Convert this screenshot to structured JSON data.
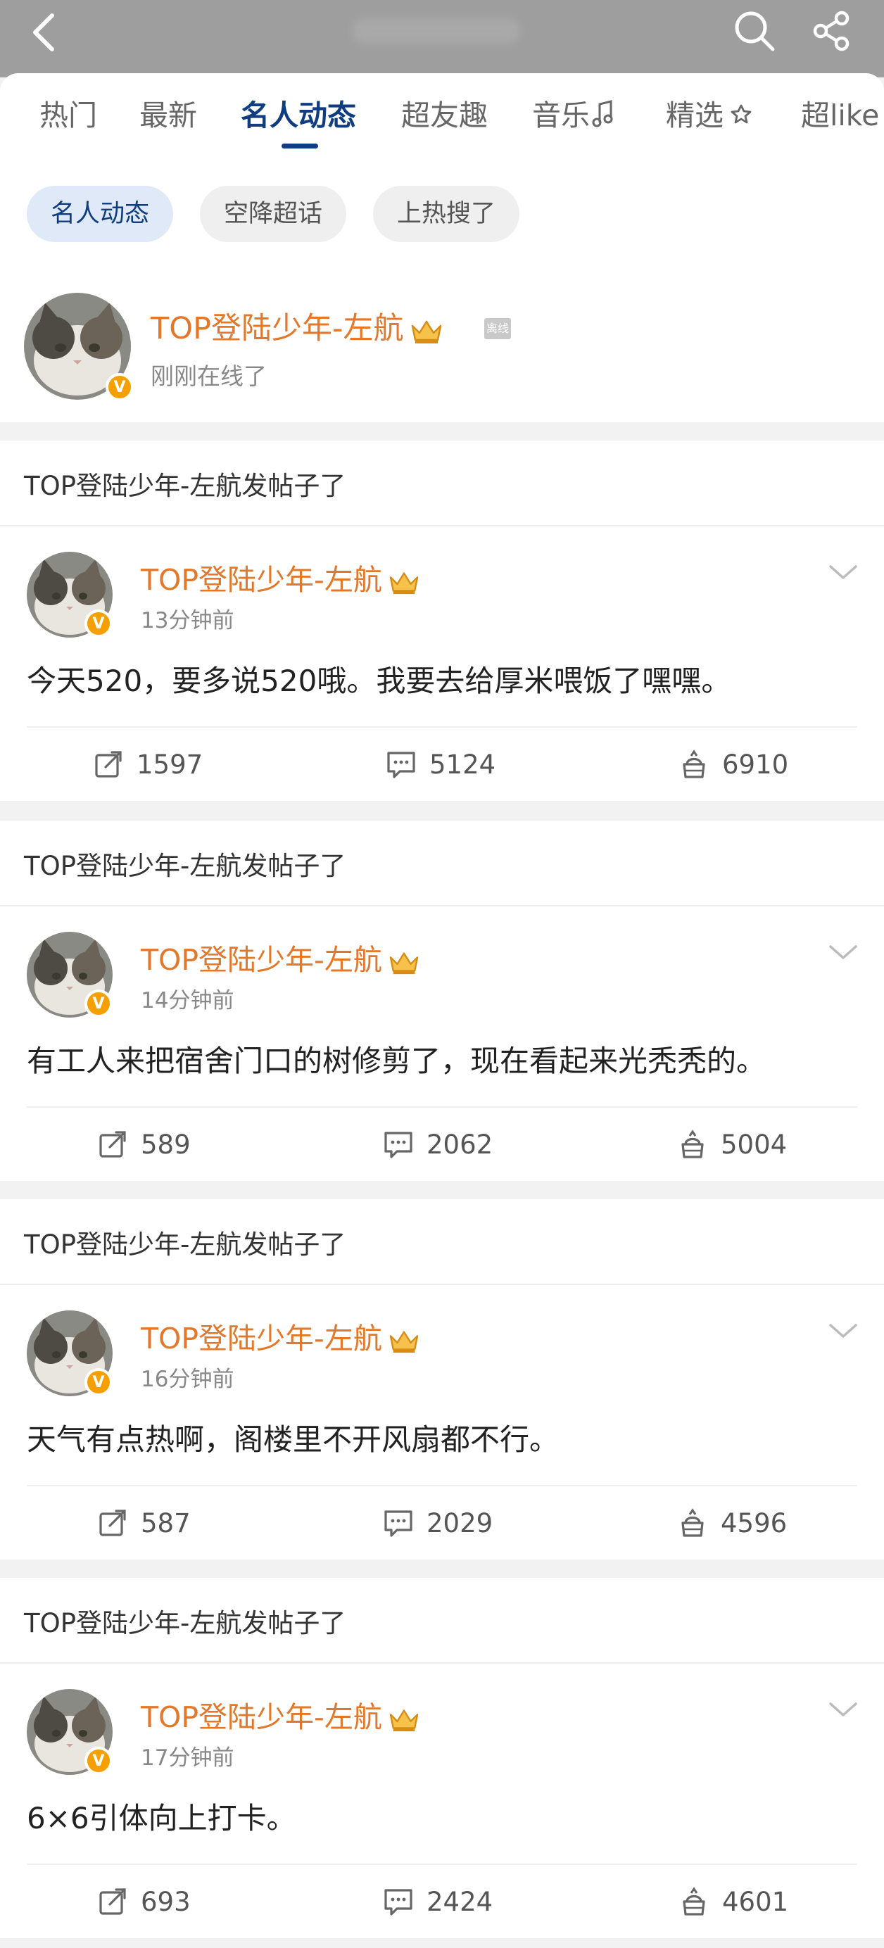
{
  "tabs": [
    {
      "label": "热门"
    },
    {
      "label": "最新"
    },
    {
      "label": "名人动态"
    },
    {
      "label": "超友趣"
    },
    {
      "label": "音乐"
    },
    {
      "label": "精选"
    },
    {
      "label": "超like"
    }
  ],
  "active_tab": "名人动态",
  "chips": [
    {
      "label": "名人动态"
    },
    {
      "label": "空降超话"
    },
    {
      "label": "上热搜了"
    }
  ],
  "profile": {
    "name": "TOP登陆少年-左航",
    "offline_tag": "离线",
    "status": "刚刚在线了"
  },
  "posts": [
    {
      "header": "TOP登陆少年-左航发帖子了",
      "author": "TOP登陆少年-左航",
      "time": "13分钟前",
      "content": "今天520，要多说520哦。我要去给厚米喂饭了嘿嘿。",
      "reposts": "1597",
      "comments": "5124",
      "likes": "6910"
    },
    {
      "header": "TOP登陆少年-左航发帖子了",
      "author": "TOP登陆少年-左航",
      "time": "14分钟前",
      "content": "有工人来把宿舍门口的树修剪了，现在看起来光秃秃的。",
      "reposts": "589",
      "comments": "2062",
      "likes": "5004"
    },
    {
      "header": "TOP登陆少年-左航发帖子了",
      "author": "TOP登陆少年-左航",
      "time": "16分钟前",
      "content": "天气有点热啊，阁楼里不开风扇都不行。",
      "reposts": "587",
      "comments": "2029",
      "likes": "4596"
    },
    {
      "header": "TOP登陆少年-左航发帖子了",
      "author": "TOP登陆少年-左航",
      "time": "17分钟前",
      "content": "6×6引体向上打卡。",
      "reposts": "693",
      "comments": "2424",
      "likes": "4601"
    }
  ],
  "badge_letter": "V",
  "colors": {
    "accent": "#0f3d80",
    "name": "#e4782a",
    "verified": "#f5a000",
    "topbar": "#9e9e9e"
  },
  "icons": [
    "back-icon",
    "search-icon",
    "share-icon",
    "crown-icon",
    "repost-icon",
    "comment-icon",
    "like-icon",
    "chevron-down-icon"
  ]
}
